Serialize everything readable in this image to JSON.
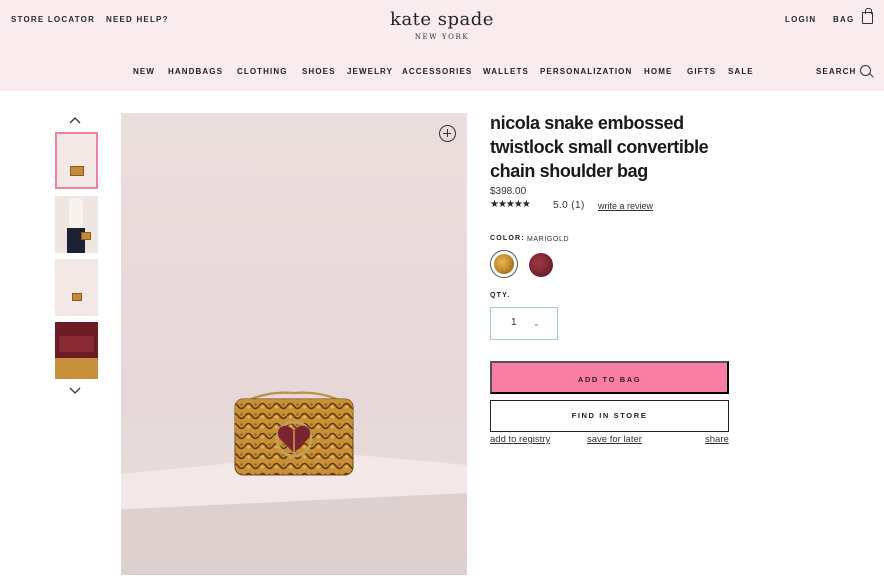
{
  "header": {
    "store_locator": "STORE LOCATOR",
    "need_help": "NEED HELP?",
    "logo": "kate spade",
    "logo_sub": "NEW YORK",
    "login": "LOGIN",
    "bag": "BAG",
    "search": "SEARCH",
    "background": "#f9ebee"
  },
  "nav": {
    "items": [
      "NEW",
      "HANDBAGS",
      "CLOTHING",
      "SHOES",
      "JEWELRY",
      "ACCESSORIES",
      "WALLETS",
      "PERSONALIZATION",
      "HOME",
      "GIFTS",
      "SALE"
    ]
  },
  "gallery": {
    "thumbnails": [
      "front view",
      "worn on model",
      "front view small",
      "interior detail"
    ],
    "active_index": 0
  },
  "product": {
    "title": "nicola snake embossed twistlock small convertible chain shoulder bag",
    "price": "$398.00",
    "stars": "★★★★★",
    "rating": "5.0 (1)",
    "review_link": "write a review",
    "color_label": "COLOR:",
    "color_value": "MARIGOLD",
    "swatches": [
      {
        "name": "marigold",
        "color": "#c9932f",
        "selected": true
      },
      {
        "name": "burgundy",
        "color": "#7a2530",
        "selected": false
      }
    ],
    "qty_label": "QTY.",
    "qty_value": "1",
    "add_to_bag": "ADD TO BAG",
    "find_in_store": "FIND IN STORE",
    "add_to_registry": "add to registry",
    "save_for_later": "save for later",
    "share": "share",
    "accent_color": "#f87ea4"
  }
}
